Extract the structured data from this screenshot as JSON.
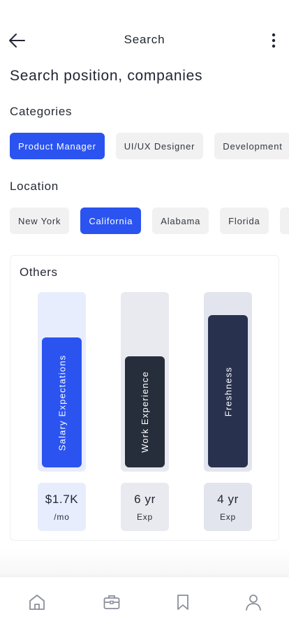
{
  "header": {
    "title": "Search",
    "back_icon": "arrow-left-icon",
    "more_icon": "more-vertical-icon"
  },
  "search": {
    "title": "Search position, companies"
  },
  "categories": {
    "label": "Categories",
    "items": [
      {
        "label": "Product Manager",
        "active": true
      },
      {
        "label": "UI/UX Designer",
        "active": false
      },
      {
        "label": "Development",
        "active": false
      }
    ]
  },
  "location": {
    "label": "Location",
    "items": [
      {
        "label": "New York",
        "active": false
      },
      {
        "label": "California",
        "active": true
      },
      {
        "label": "Alabama",
        "active": false
      },
      {
        "label": "Florida",
        "active": false
      },
      {
        "label": "",
        "active": false
      }
    ]
  },
  "others": {
    "title": "Others",
    "bars": [
      {
        "label": "Salary Expectations",
        "value": "$1.7K",
        "unit": "/mo",
        "fill_fraction": 0.76,
        "fill_color": "#2a53f0",
        "track_color": "#e8edfd",
        "value_bg": "#e8edfd"
      },
      {
        "label": "Work Experience",
        "value": "6 yr",
        "unit": "Exp",
        "fill_fraction": 0.65,
        "fill_color": "#272e3b",
        "track_color": "#e8eaf0",
        "value_bg": "#e8eaf0"
      },
      {
        "label": "Freshness",
        "value": "4 yr",
        "unit": "Exp",
        "fill_fraction": 0.89,
        "fill_color": "#28324f",
        "track_color": "#e2e5ee",
        "value_bg": "#e2e5ee"
      }
    ]
  },
  "nav": {
    "items": [
      {
        "icon": "home-icon"
      },
      {
        "icon": "briefcase-icon"
      },
      {
        "icon": "bookmark-icon"
      },
      {
        "icon": "user-icon"
      }
    ]
  },
  "colors": {
    "accent": "#2a53f0",
    "chip_bg": "#f1f1f1",
    "text": "#1f2430"
  }
}
